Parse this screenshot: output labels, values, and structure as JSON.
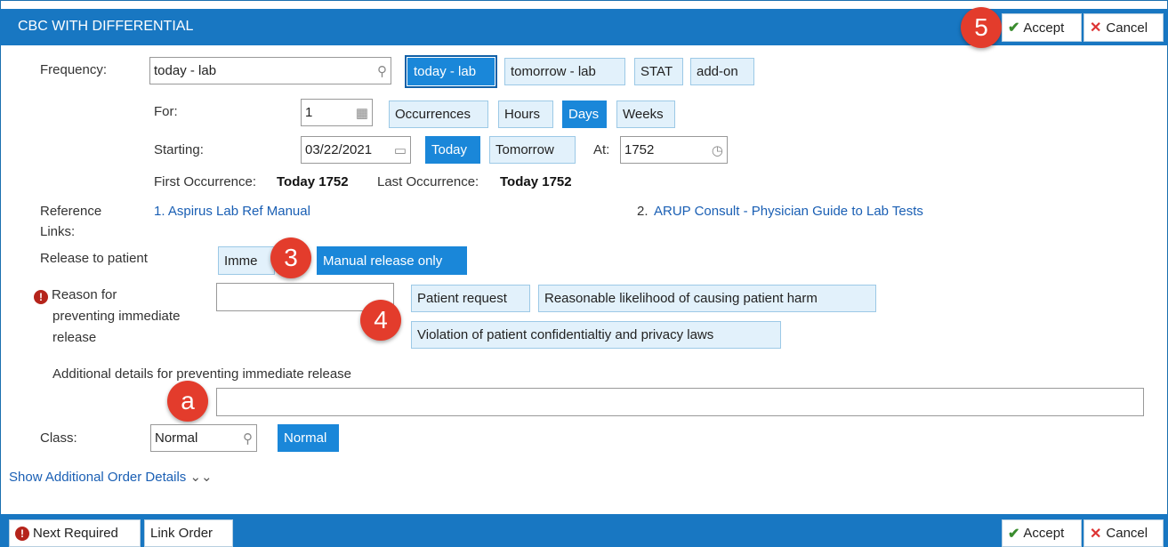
{
  "header": {
    "title": "CBC WITH DIFFERENTIAL",
    "accept_label": "Accept",
    "cancel_label": "Cancel",
    "badge": "5"
  },
  "frequency": {
    "label": "Frequency:",
    "value": "today - lab",
    "options": [
      "today - lab",
      "tomorrow - lab",
      "STAT",
      "add-on"
    ],
    "selected": "today - lab"
  },
  "for": {
    "label": "For:",
    "value": "1",
    "units": [
      "Occurrences",
      "Hours",
      "Days",
      "Weeks"
    ],
    "selected": "Days"
  },
  "starting": {
    "label": "Starting:",
    "date": "03/22/2021",
    "today_label": "Today",
    "tomorrow_label": "Tomorrow",
    "at_label": "At:",
    "time": "1752"
  },
  "occurrence": {
    "first_label": "First Occurrence:",
    "first_value": "Today 1752",
    "last_label": "Last Occurrence:",
    "last_value": "Today 1752"
  },
  "reference": {
    "label_line1": "Reference",
    "label_line2": "Links:",
    "link1": "1. Aspirus Lab Ref Manual",
    "link2_prefix": "2.",
    "link2": "ARUP Consult - Physician Guide to Lab Tests"
  },
  "release": {
    "label": "Release to patient",
    "option_immediate": "Imme",
    "option_manual": "Manual release only",
    "badge": "3"
  },
  "reason": {
    "label_line1": "Reason for",
    "label_line2": "preventing immediate",
    "label_line3": "release",
    "options": [
      "Patient request",
      "Reasonable likelihood of causing patient harm",
      "Violation of patient confidentialtiy and privacy laws"
    ],
    "badge": "4"
  },
  "additional": {
    "label": "Additional details for preventing immediate release",
    "badge": "a"
  },
  "class": {
    "label": "Class:",
    "value": "Normal",
    "option": "Normal"
  },
  "show_more": "Show Additional Order Details",
  "footer": {
    "next_required": "Next Required",
    "link_order": "Link Order",
    "accept_label": "Accept",
    "cancel_label": "Cancel"
  }
}
